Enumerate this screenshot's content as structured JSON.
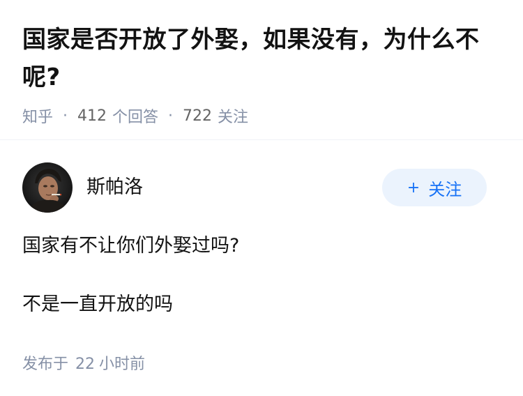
{
  "question": {
    "title": "国家是否开放了外娶，如果没有，为什么不呢?",
    "source": "知乎",
    "answer_count": "412",
    "answer_unit": "个回答",
    "follower_count": "722",
    "follower_unit": "关注"
  },
  "answer": {
    "author_name": "斯帕洛",
    "follow_button": {
      "icon": "plus-icon",
      "label": "关注"
    },
    "paragraphs": [
      "国家有不让你们外娶过吗?",
      "不是一直开放的吗"
    ],
    "published_prefix": "发布于",
    "published_num": "22",
    "published_suffix": "小时前"
  },
  "colors": {
    "meta_gray": "#8590a6",
    "accent_blue": "#1772f6",
    "button_bg": "#ebf3fd"
  }
}
